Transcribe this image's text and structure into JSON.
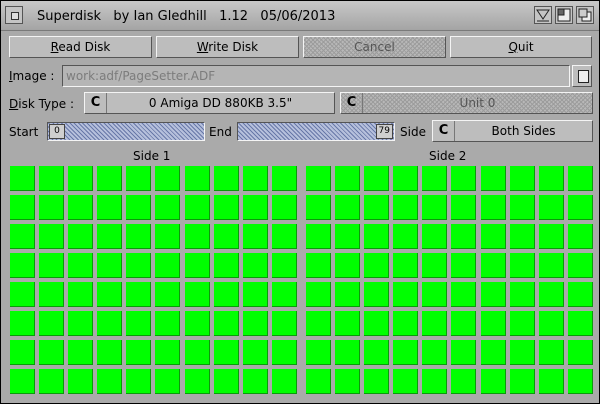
{
  "window": {
    "title": "Superdisk   by Ian Gledhill   1.12   05/06/2013"
  },
  "buttons": {
    "read_prefix": "R",
    "read_rest": "ead Disk",
    "write_prefix": "W",
    "write_rest": "rite Disk",
    "cancel": "Cancel",
    "quit_prefix": "Q",
    "quit_rest": "uit"
  },
  "image": {
    "label_prefix": "I",
    "label_rest": "mage :",
    "value": "work:adf/PageSetter.ADF"
  },
  "disk_type": {
    "label_prefix": "D",
    "label_rest": "isk Type :",
    "selected": "0 Amiga DD 880KB 3.5\"",
    "unit": "Unit 0",
    "cycle_glyph": "C"
  },
  "range": {
    "start_label": "Start",
    "start_value": "0",
    "end_label": "End",
    "end_value": "79",
    "side_label": "Side",
    "side_selected": "Both Sides"
  },
  "tracks": {
    "side1_title": "Side 1",
    "side2_title": "Side 2",
    "columns": 10,
    "rows": 8,
    "status_color": "#00ff00"
  }
}
